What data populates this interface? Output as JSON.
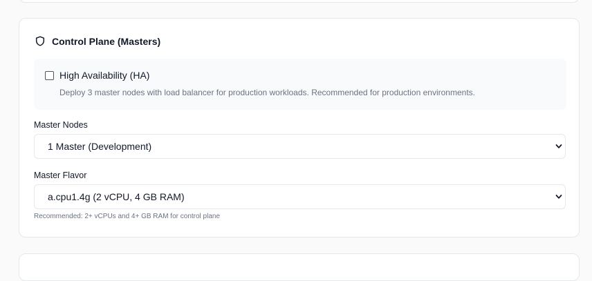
{
  "control_plane": {
    "title": "Control Plane (Masters)",
    "icon": "shield-icon",
    "ha": {
      "label": "High Availability (HA)",
      "description": "Deploy 3 master nodes with load balancer for production workloads. Recommended for production environments.",
      "checked": false
    },
    "master_nodes": {
      "label": "Master Nodes",
      "value": "1 Master (Development)"
    },
    "master_flavor": {
      "label": "Master Flavor",
      "value": "a.cpu1.4g (2 vCPU, 4 GB RAM)",
      "hint": "Recommended: 2+ vCPUs and 4+ GB RAM for control plane"
    }
  }
}
